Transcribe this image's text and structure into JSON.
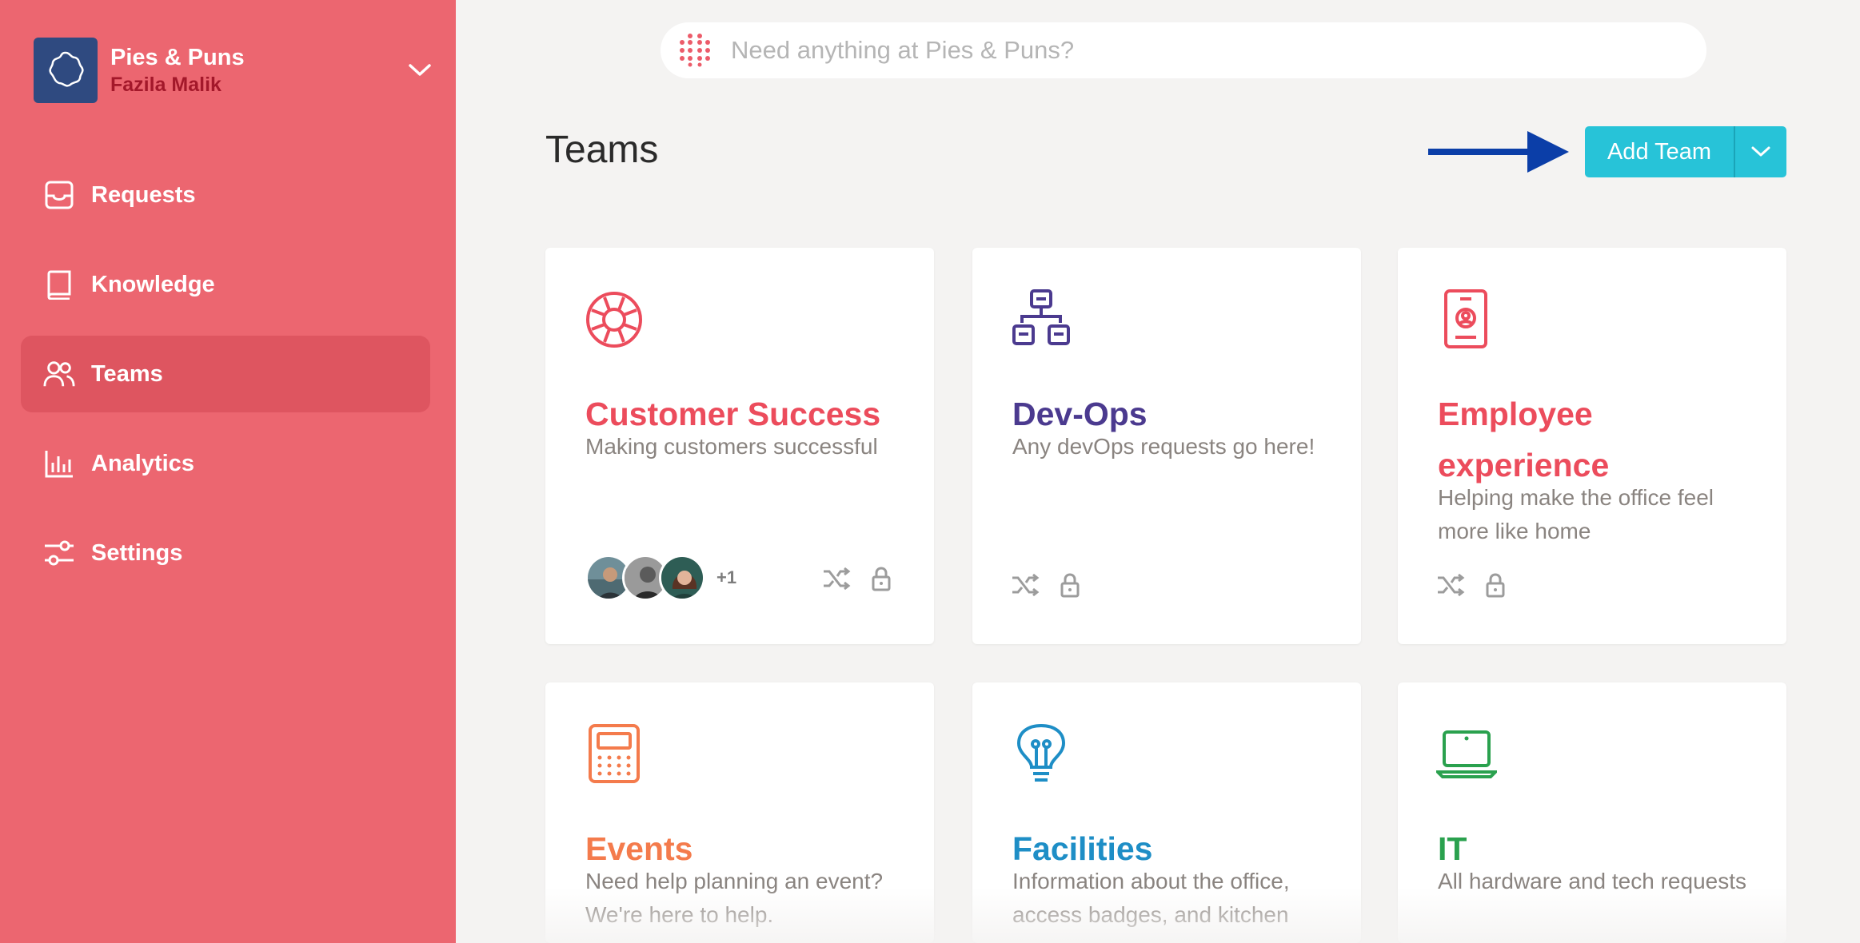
{
  "workspace": {
    "name": "Pies & Puns",
    "user": "Fazila Malik"
  },
  "nav": [
    {
      "label": "Requests",
      "icon": "inbox-icon",
      "active": false
    },
    {
      "label": "Knowledge",
      "icon": "book-icon",
      "active": false
    },
    {
      "label": "Teams",
      "icon": "users-icon",
      "active": true
    },
    {
      "label": "Analytics",
      "icon": "bar-chart-icon",
      "active": false
    },
    {
      "label": "Settings",
      "icon": "sliders-icon",
      "active": false
    }
  ],
  "search": {
    "placeholder": "Need anything at Pies & Puns?"
  },
  "page": {
    "title": "Teams",
    "add_button": "Add Team"
  },
  "teams": [
    {
      "title": "Customer Success",
      "description": "Making customers successful",
      "color": "#ec4c5c",
      "icon": "lifebuoy-icon",
      "extra_members": "+1"
    },
    {
      "title": "Dev-Ops",
      "description": "Any devOps requests go here!",
      "color": "#4b3a8f",
      "icon": "network-icon"
    },
    {
      "title": "Employee experience",
      "description": "Helping make the office feel more like home",
      "color": "#ec4c5c",
      "icon": "badge-icon"
    },
    {
      "title": "Events",
      "description": "Need help planning an event? We're here to help.",
      "color": "#f47b4c",
      "icon": "calendar-icon"
    },
    {
      "title": "Facilities",
      "description": "Information about the office, access badges, and kitchen",
      "color": "#1e8ec6",
      "icon": "lightbulb-icon"
    },
    {
      "title": "IT",
      "description": "All hardware and tech requests",
      "color": "#2aa14e",
      "icon": "laptop-icon"
    }
  ],
  "colors": {
    "sidebar": "#ec6670",
    "accent": "#27c3d8",
    "arrow": "#0b3ea8"
  }
}
